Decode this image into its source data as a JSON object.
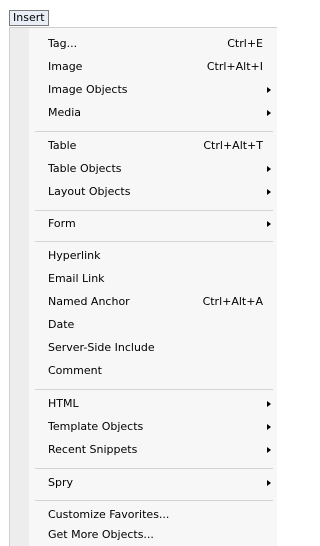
{
  "menubar": {
    "title": "Insert"
  },
  "menu": {
    "items": [
      {
        "label": "Tag...",
        "shortcut": "Ctrl+E",
        "submenu": false
      },
      {
        "label": "Image",
        "shortcut": "Ctrl+Alt+I",
        "submenu": false
      },
      {
        "label": "Image Objects",
        "shortcut": "",
        "submenu": true
      },
      {
        "label": "Media",
        "shortcut": "",
        "submenu": true
      },
      {
        "label": "Table",
        "shortcut": "Ctrl+Alt+T",
        "submenu": false
      },
      {
        "label": "Table Objects",
        "shortcut": "",
        "submenu": true
      },
      {
        "label": "Layout Objects",
        "shortcut": "",
        "submenu": true
      },
      {
        "label": "Form",
        "shortcut": "",
        "submenu": true
      },
      {
        "label": "Hyperlink",
        "shortcut": "",
        "submenu": false
      },
      {
        "label": "Email Link",
        "shortcut": "",
        "submenu": false
      },
      {
        "label": "Named Anchor",
        "shortcut": "Ctrl+Alt+A",
        "submenu": false
      },
      {
        "label": "Date",
        "shortcut": "",
        "submenu": false
      },
      {
        "label": "Server-Side Include",
        "shortcut": "",
        "submenu": false
      },
      {
        "label": "Comment",
        "shortcut": "",
        "submenu": false
      },
      {
        "label": "HTML",
        "shortcut": "",
        "submenu": true
      },
      {
        "label": "Template Objects",
        "shortcut": "",
        "submenu": true
      },
      {
        "label": "Recent Snippets",
        "shortcut": "",
        "submenu": true
      },
      {
        "label": "Spry",
        "shortcut": "",
        "submenu": true
      },
      {
        "label": "Customize Favorites...",
        "shortcut": "",
        "submenu": false
      },
      {
        "label": "Get More Objects...",
        "shortcut": "",
        "submenu": false
      }
    ]
  }
}
